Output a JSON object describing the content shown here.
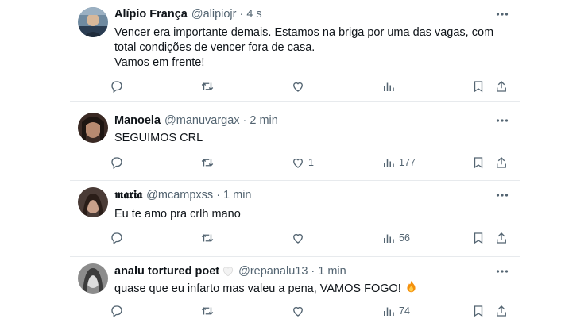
{
  "tweets": [
    {
      "name": "Alípio França",
      "handle": "@alipiojr",
      "time": "4 s",
      "lines": [
        "Vencer era importante demais. Estamos na briga por uma das vagas, com",
        "total condições de vencer fora de casa.",
        "Vamos em frente!"
      ],
      "stats": {
        "replies": "",
        "retweets": "",
        "likes": "",
        "views": ""
      }
    },
    {
      "name": "Manoela",
      "handle": "@manuvargax",
      "time": "2 min",
      "lines": [
        "SEGUIMOS CRL"
      ],
      "stats": {
        "replies": "",
        "retweets": "",
        "likes": "1",
        "views": "177"
      }
    },
    {
      "name": "𝖒𝖆𝖗𝖎𝖆",
      "handle": "@mcampxss",
      "time": "1 min",
      "lines": [
        "Eu te amo pra crlh mano"
      ],
      "stats": {
        "replies": "",
        "retweets": "",
        "likes": "",
        "views": "56"
      }
    },
    {
      "name": "analu tortured poet",
      "handle": "@repanalu13",
      "time": "1 min",
      "lines": [
        "quase que eu infarto mas valeu a pena, VAMOS FOGO!"
      ],
      "stats": {
        "replies": "",
        "retweets": "",
        "likes": "",
        "views": "74"
      }
    }
  ],
  "separator": "·",
  "icons": {
    "more": "more-options-icon",
    "reply": "reply-icon",
    "retweet": "retweet-icon",
    "like": "heart-icon",
    "views": "views-chart-icon",
    "bookmark": "bookmark-icon",
    "share": "share-icon",
    "name_badge": "white-heart-icon",
    "emoji": "fire-emoji-icon"
  },
  "colors": {
    "text": "#0f1419",
    "muted": "#536471",
    "border": "#e7eaed"
  }
}
